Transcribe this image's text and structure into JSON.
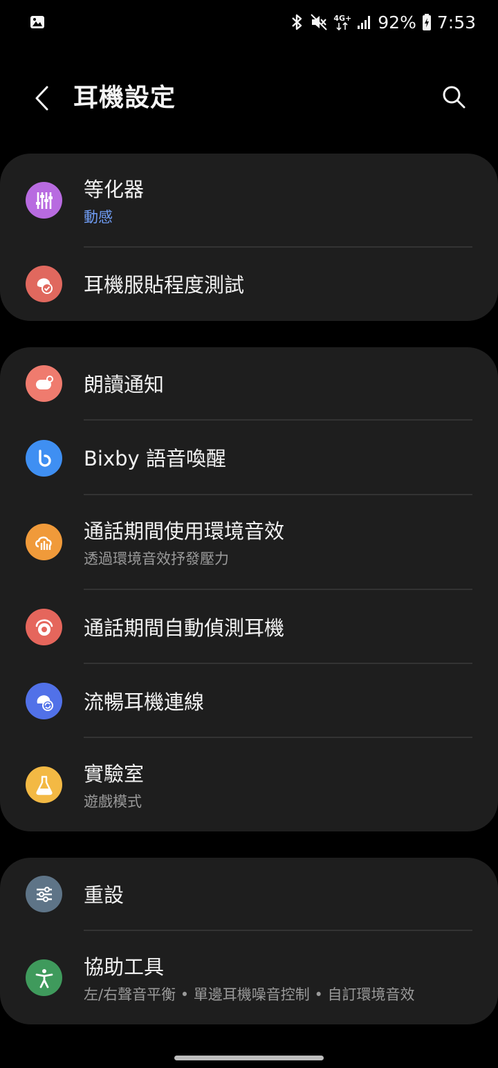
{
  "status_bar": {
    "network": "4G+",
    "battery": "92%",
    "time": "7:53"
  },
  "header": {
    "title": "耳機設定"
  },
  "cards": [
    {
      "items": [
        {
          "title": "等化器",
          "subtitle": "動感",
          "icon": "equalizer-icon",
          "color": "#b86be0"
        },
        {
          "title": "耳機服貼程度測試",
          "icon": "ear-fit-test-icon",
          "color": "#e0685e"
        }
      ]
    },
    {
      "items": [
        {
          "title": "朗讀通知",
          "icon": "read-notifications-icon",
          "color": "#ef7b6e"
        },
        {
          "title": "Bixby 語音喚醒",
          "icon": "bixby-icon",
          "color": "#3f8ff2"
        },
        {
          "title": "通話期間使用環境音效",
          "subtitle": "透過環境音效抒發壓力",
          "icon": "ambient-sound-icon",
          "color": "#f09a3a"
        },
        {
          "title": "通話期間自動偵測耳機",
          "icon": "auto-detect-icon",
          "color": "#e5665c"
        },
        {
          "title": "流暢耳機連線",
          "icon": "seamless-connection-icon",
          "color": "#5171e8"
        },
        {
          "title": "實驗室",
          "subtitle": "遊戲模式",
          "icon": "labs-flask-icon",
          "color": "#f3b944"
        }
      ]
    },
    {
      "items": [
        {
          "title": "重設",
          "icon": "reset-sliders-icon",
          "color": "#5e7487"
        },
        {
          "title": "協助工具",
          "subtitle": "左/右聲音平衡 • 單邊耳機噪音控制 • 自訂環境音效",
          "icon": "accessibility-icon",
          "color": "#3f9a5c"
        }
      ]
    }
  ]
}
